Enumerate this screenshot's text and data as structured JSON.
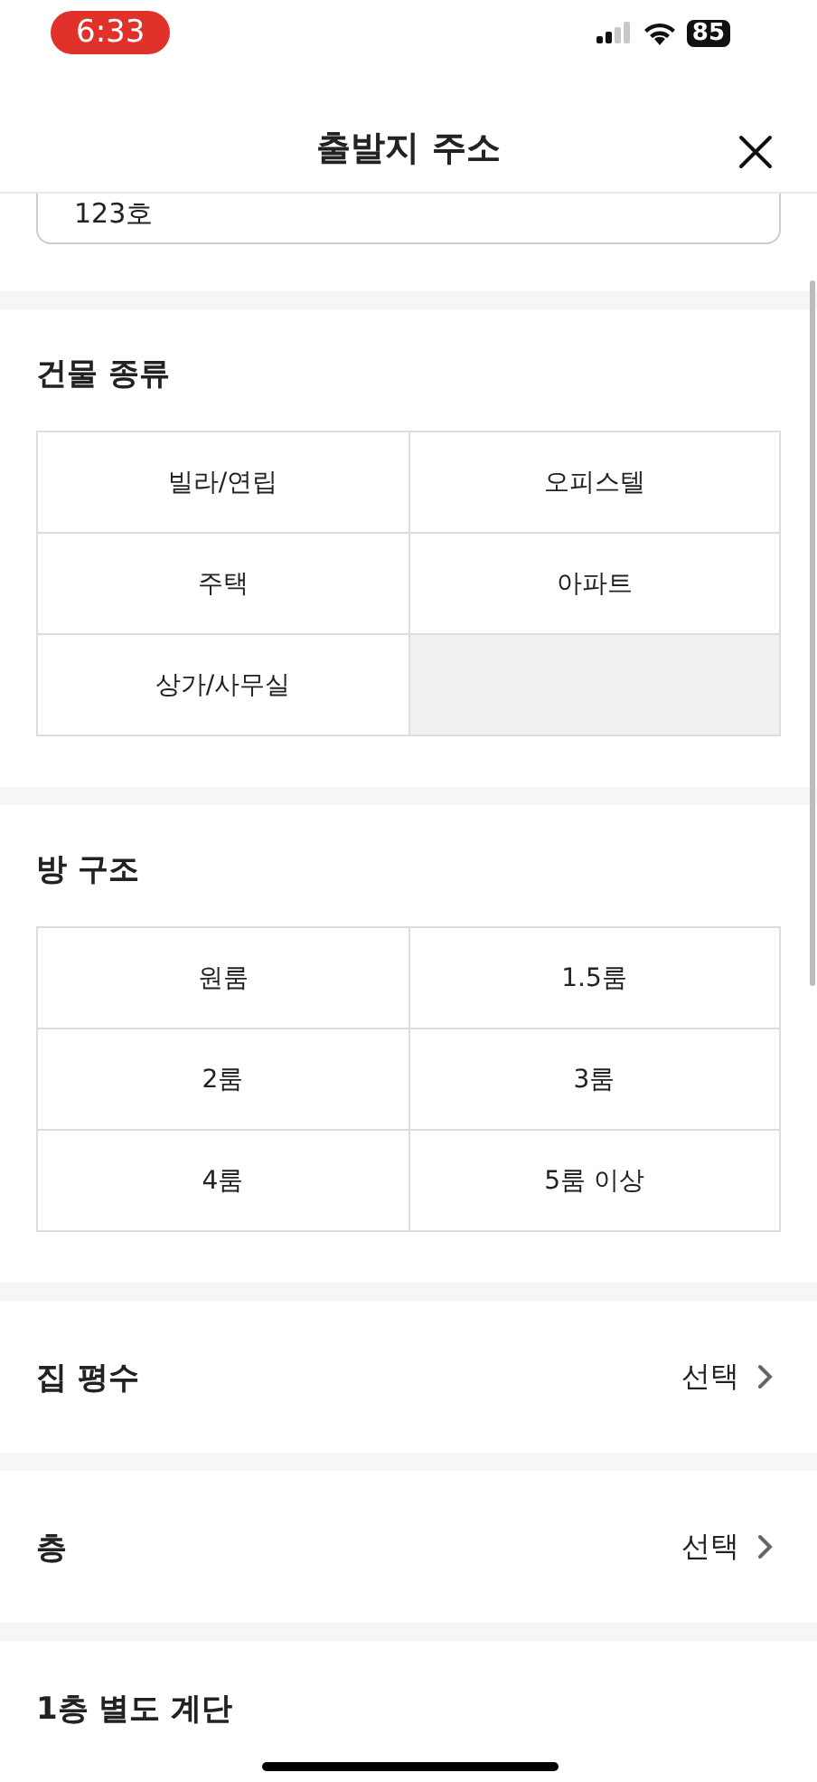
{
  "status_bar": {
    "time": "6:33",
    "battery": "85"
  },
  "header": {
    "title": "출발지 주소"
  },
  "address_field": {
    "value": "123호"
  },
  "building_type": {
    "title": "건물 종류",
    "options": [
      "빌라/연립",
      "오피스텔",
      "주택",
      "아파트",
      "상가/사무실"
    ]
  },
  "room_layout": {
    "title": "방 구조",
    "options": [
      "원룸",
      "1.5룸",
      "2룸",
      "3룸",
      "4룸",
      "5룸 이상"
    ]
  },
  "pickers": [
    {
      "label": "집 평수",
      "value": "선택"
    },
    {
      "label": "층",
      "value": "선택"
    }
  ],
  "next_section": {
    "title": "1층 별도 계단"
  }
}
